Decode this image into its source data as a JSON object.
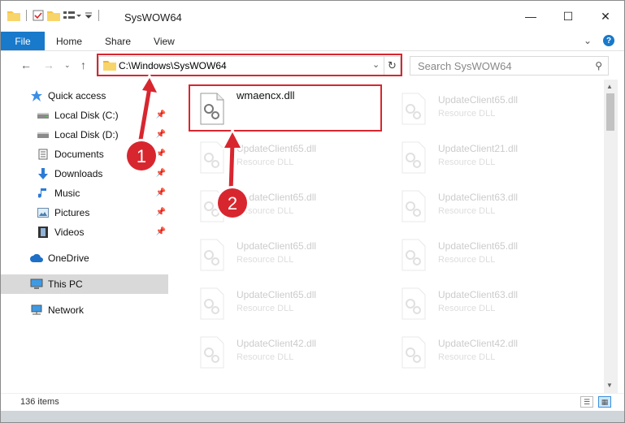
{
  "window": {
    "title": "SysWOW64"
  },
  "ribbon": {
    "file_label": "File",
    "tabs": [
      {
        "label": "Home"
      },
      {
        "label": "Share"
      },
      {
        "label": "View"
      }
    ]
  },
  "address_bar": {
    "path": "C:\\Windows\\SysWOW64",
    "search_placeholder": "Search SysWOW64"
  },
  "nav_pane": {
    "items": [
      {
        "label": "Quick access",
        "icon": "star-icon",
        "pinned": false
      },
      {
        "label": "Local Disk (C:)",
        "icon": "drive-icon",
        "pinned": true
      },
      {
        "label": "Local Disk (D:)",
        "icon": "drive-icon",
        "pinned": true
      },
      {
        "label": "Documents",
        "icon": "documents-icon",
        "pinned": true
      },
      {
        "label": "Downloads",
        "icon": "download-arrow-icon",
        "pinned": true
      },
      {
        "label": "Music",
        "icon": "music-note-icon",
        "pinned": true
      },
      {
        "label": "Pictures",
        "icon": "pictures-icon",
        "pinned": true
      },
      {
        "label": "Videos",
        "icon": "film-icon",
        "pinned": true
      },
      {
        "label": "OneDrive",
        "icon": "cloud-icon",
        "pinned": false
      },
      {
        "label": "This PC",
        "icon": "computer-icon",
        "pinned": false,
        "selected": true
      },
      {
        "label": "Network",
        "icon": "network-icon",
        "pinned": false
      }
    ]
  },
  "files": [
    {
      "name": "wmaencx.dll",
      "type": ""
    },
    {
      "name": "UpdateClient65.dll",
      "type": "Resource DLL"
    },
    {
      "name": "UpdateClient65.dll",
      "type": "Resource DLL"
    },
    {
      "name": "UpdateClient21.dll",
      "type": "Resource DLL"
    },
    {
      "name": "UpdateClient65.dll",
      "type": "Resource DLL"
    },
    {
      "name": "UpdateClient63.dll",
      "type": "Resource DLL"
    },
    {
      "name": "UpdateClient65.dll",
      "type": "Resource DLL"
    },
    {
      "name": "UpdateClient65.dll",
      "type": "Resource DLL"
    },
    {
      "name": "UpdateClient65.dll",
      "type": "Resource DLL"
    },
    {
      "name": "UpdateClient63.dll",
      "type": "Resource DLL"
    },
    {
      "name": "UpdateClient42.dll",
      "type": "Resource DLL"
    },
    {
      "name": "UpdateClient42.dll",
      "type": "Resource DLL"
    }
  ],
  "status": {
    "item_count": "136 items"
  },
  "annotations": {
    "step1": "1",
    "step2": "2"
  },
  "colors": {
    "accent": "#1979ca",
    "annotation_red": "#d8262f",
    "selected_bg": "#d9d9d9"
  }
}
